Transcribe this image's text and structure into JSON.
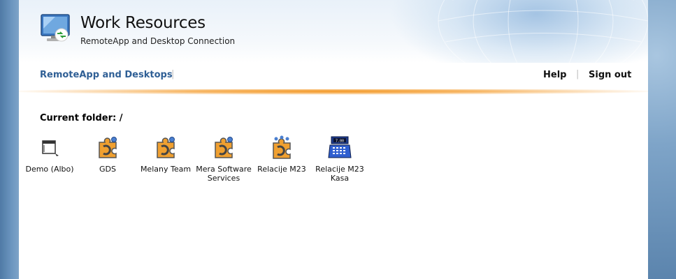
{
  "header": {
    "title": "Work Resources",
    "subtitle": "RemoteApp and Desktop Connection",
    "logo_icon": "remote-desktop-monitor-icon"
  },
  "nav": {
    "main_link": "RemoteApp and Desktops",
    "help": "Help",
    "sign_out": "Sign out"
  },
  "folder": {
    "label": "Current folder: /"
  },
  "apps": [
    {
      "label": "Demo (Albo)",
      "icon": "app-window-icon"
    },
    {
      "label": "GDS",
      "icon": "puzzle-icon"
    },
    {
      "label": "Melany Team",
      "icon": "puzzle-icon"
    },
    {
      "label": "Mera Software Services",
      "icon": "puzzle-icon"
    },
    {
      "label": "Relacije M23",
      "icon": "puzzle-people-icon"
    },
    {
      "label": "Relacije M23 Kasa",
      "icon": "cash-register-icon"
    }
  ],
  "colors": {
    "accent_blue": "#2f5f95",
    "orange_rule": "#f39a2a",
    "puzzle_orange": "#f0a030"
  }
}
